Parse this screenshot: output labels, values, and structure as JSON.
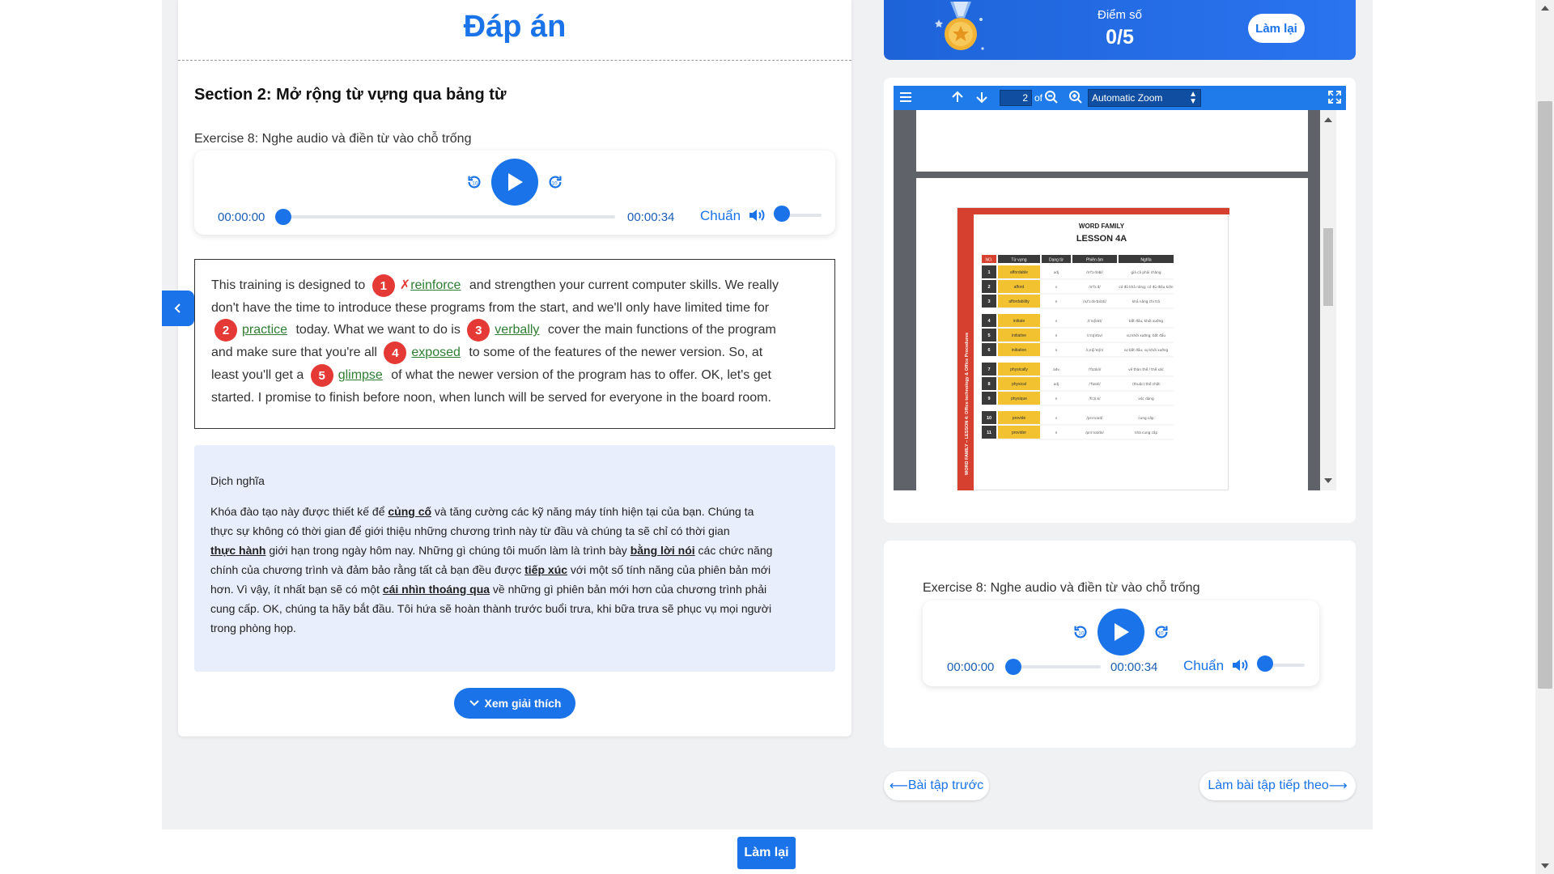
{
  "answer_panel": {
    "title": "Đáp án",
    "section_title": "Section 2: Mở rộng từ vựng qua bảng từ",
    "exercise_title": "Exercise 8: Nghe audio và điền từ vào chỗ trống",
    "audio": {
      "current_time": "00:00:00",
      "duration": "00:00:34",
      "speed_label": "Chuẩn",
      "progress": 0,
      "volume": 0
    },
    "passage": {
      "l1a": "This training is designed to",
      "a1_wrong": "✗",
      "a1": "reinforce",
      "l1b": "and strengthen your current computer skills. We really",
      "l2": "don't have the time to introduce these programs from the start, and we'll only have limited time for",
      "a2": "practice",
      "l3a": "today. What we want to do is",
      "a3": "verbally",
      "l3b": "cover the main functions of the program",
      "l4a": "and make sure that you're all",
      "a4": "exposed",
      "l4b": "to some of the features of the newer version. So, at",
      "l5a": "least you'll get a",
      "a5": "glimpse",
      "l5b": "of what the newer version of the program has to offer. OK, let's get",
      "l6": "started. I promise to finish before noon, when lunch will be served for everyone in the board room.",
      "n1": "1",
      "n2": "2",
      "n3": "3",
      "n4": "4",
      "n5": "5"
    },
    "translation": {
      "heading": "Dịch nghĩa",
      "t1a": "Khóa đào tạo này được thiết kế để ",
      "k1": "củng cố",
      "t1b": " và tăng cường các kỹ năng máy tính hiện tại của bạn. Chúng ta",
      "t2": "thực sự không có thời gian để giới thiệu những chương trình này từ đầu và chúng ta sẽ chỉ có thời gian",
      "k2": "thực hành",
      "t3a": " giới hạn trong ngày hôm nay. Những gì chúng tôi muốn làm là trình bày ",
      "k3": "bằng lời nói",
      "t3b": " các chức năng",
      "t4a": "chính của chương trình và đảm bảo rằng tất cả bạn đều được ",
      "k4": "tiếp xúc",
      "t4b": " với một số tính năng của phiên bản mới",
      "t5a": "hơn. Vì vậy, ít nhất bạn sẽ có một ",
      "k5": "cái nhìn thoáng qua",
      "t5b": " về những gì phiên bản mới hơn của chương trình phải",
      "t6": "cung cấp. OK, chúng ta hãy bắt đầu. Tôi hứa sẽ hoàn thành trước buổi trưa, khi bữa trưa sẽ phục vụ mọi người",
      "t7": "trong phòng họp."
    },
    "explain_button": "Xem giải thích"
  },
  "score": {
    "label": "Điểm số",
    "value": "0/5",
    "retry": "Làm lại"
  },
  "pdf_viewer": {
    "page_number": "2",
    "of_label": "of",
    "zoom": "Automatic Zoom",
    "doc": {
      "header": "WORD FAMILY",
      "lesson": "LESSON 4A",
      "side_text": "WORD FAMILY – LESSON 4: Office technology & Office Procedures",
      "columns": [
        "NO.",
        "Từ vựng",
        "Dạng từ",
        "Phiên âm",
        "Nghĩa"
      ],
      "rows": [
        [
          "1",
          "affordable",
          "adj",
          "/əˈfɔːdəbl/",
          "giá cả phải chăng"
        ],
        [
          "2",
          "afford",
          "v",
          "/əˈfɔːd/",
          "có đủ khả năng; có đủ điều kiện"
        ],
        [
          "3",
          "affordability",
          "n",
          "/əˌfɔːdəˈbɪləti/",
          "khả năng chi trả"
        ],
        [
          "4",
          "initiate",
          "v",
          "/ɪˈnɪʃieɪt/",
          "bắt đầu, khởi xướng"
        ],
        [
          "5",
          "initiative",
          "n",
          "/ɪˈnɪʃətɪv/",
          "sự khởi xướng; bắt đầu"
        ],
        [
          "6",
          "initiation",
          "n",
          "/ɪˌnɪʃiˈeɪʃn/",
          "sự bắt đầu; sự khởi xướng"
        ],
        [
          "7",
          "physically",
          "adv",
          "/ˈfɪzɪkli/",
          "về thân thể / thể xác"
        ],
        [
          "8",
          "physical",
          "adj",
          "/ˈfɪzɪkl/",
          "(thuộc) thể chất"
        ],
        [
          "9",
          "physique",
          "n",
          "/fɪˈziːk/",
          "vóc dáng"
        ],
        [
          "10",
          "provide",
          "v",
          "/prəˈvaɪd/",
          "cung cấp"
        ],
        [
          "11",
          "provider",
          "n",
          "/prəˈvaɪdə/",
          "nhà cung cấp"
        ]
      ]
    }
  },
  "exercise_card": {
    "exercise_title": "Exercise 8: Nghe audio và điền từ vào chỗ trống",
    "audio": {
      "current_time": "00:00:00",
      "duration": "00:00:34",
      "speed_label": "Chuẩn",
      "progress": 0,
      "volume": 0
    }
  },
  "navigation": {
    "prev": "Bài tập trước",
    "next": "Làm bài tập tiếp theo"
  },
  "bottom_bar": {
    "retry": "Làm lại"
  },
  "colors": {
    "primary": "#1a73e8",
    "error": "#e53935",
    "correct": "#2e7d32",
    "translation_bg": "#e8eefb"
  }
}
